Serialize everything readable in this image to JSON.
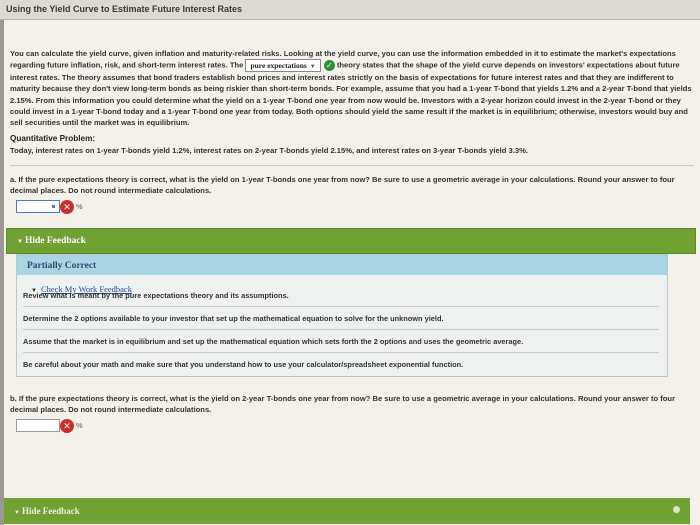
{
  "page": {
    "title": "Using the Yield Curve to Estimate Future Interest Rates"
  },
  "intro": {
    "part1": "You can calculate the yield curve, given inflation and maturity-related risks. Looking at the yield curve, you can use the information embedded in it to estimate the market's expectations regarding future inflation, risk, and short-term interest rates. The",
    "dropdown_value": "pure expectations",
    "part2": "theory states that the shape of the yield curve depends on investors' expectations about future interest rates. The theory assumes that bond traders establish bond prices and interest rates strictly on the basis of expectations for future interest rates and that they are indifferent to maturity because they don't view long-term bonds as being riskier than short-term bonds. For example, assume that you had a 1-year T-bond that yields 1.2% and a 2-year T-bond that yields 2.15%. From this information you could determine what the yield on a 1-year T-bond one year from now would be. Investors with a 2-year horizon could invest in the 2-year T-bond or they could invest in a 1-year T-bond today and a 1-year T-bond one year from today. Both options should yield the same result if the market is in equilibrium; otherwise, investors would buy and sell securities until the market was in equilibrium."
  },
  "quantitative": {
    "heading": "Quantitative Problem:",
    "text": "Today, interest rates on 1-year T-bonds yield 1.2%, interest rates on 2-year T-bonds yield 2.15%, and interest rates on 3-year T-bonds yield 3.3%."
  },
  "question_a": {
    "text": "a. If the pure expectations theory is correct, what is the yield on 1-year T-bonds one year from now? Be sure to use a geometric average in your calculations. Round your answer to four decimal places. Do not round intermediate calculations.",
    "answer_value": "",
    "unit": "%"
  },
  "feedback_a": {
    "toggle_label": "Hide Feedback",
    "status": "Partially Correct",
    "link": "Check My Work Feedback",
    "lines": [
      "Review what is meant by the pure expectations theory and its assumptions.",
      "Determine the 2 options available to your investor that set up the mathematical equation to solve for the unknown yield.",
      "Assume that the market is in equilibrium and set up the mathematical equation which sets forth the 2 options and uses the geometric average.",
      "Be careful about your math and make sure that you understand how to use your calculator/spreadsheet exponential function."
    ]
  },
  "question_b": {
    "text": "b. If the pure expectations theory is correct, what is the yield on 2-year T-bonds one year from now? Be sure to use a geometric average in your calculations. Round your answer to four decimal places. Do not round intermediate calculations.",
    "answer_value": "",
    "unit": "%"
  },
  "feedback_b": {
    "toggle_label": "Hide Feedback"
  },
  "colors": {
    "feedback_bar": "#6fa233",
    "partial_header": "#a9d4e2",
    "error_icon": "#c9302c",
    "ok_icon": "#2f8f3a"
  }
}
